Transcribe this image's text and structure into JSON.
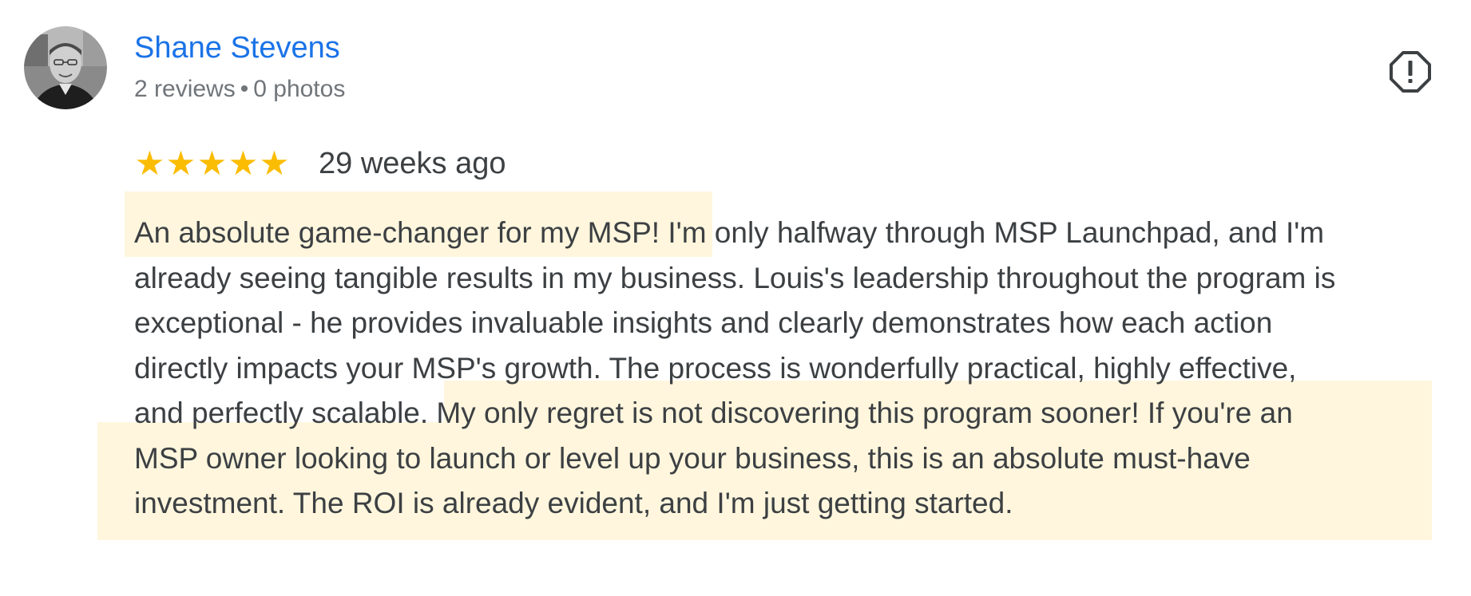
{
  "review": {
    "author": {
      "name": "Shane Stevens",
      "reviews_count": "2 reviews",
      "separator": "•",
      "photos_count": "0 photos",
      "avatar": "profile-photo"
    },
    "rating": {
      "stars": 5,
      "star_glyph": "★"
    },
    "timestamp": "29 weeks ago",
    "text_lines": [
      "An absolute game-changer for my MSP! I'm only halfway through MSP Launchpad, and I'm",
      "already seeing tangible results in my business. Louis's leadership throughout the program is",
      "exceptional - he provides invaluable insights and clearly demonstrates how each action",
      "directly impacts your MSP's growth. The process is wonderfully practical, highly effective,",
      "and perfectly scalable. My only regret is not discovering this program sooner! If you're an",
      "MSP owner looking to launch or level up your business, this is an absolute must-have",
      "investment. The ROI is already evident, and I'm just getting started."
    ],
    "flag_icon": "report-icon"
  },
  "colors": {
    "author_name": "#1a73e8",
    "meta_text": "#70757a",
    "body_text": "#3c4043",
    "star": "#fbbc04",
    "highlight": "#fff6dd"
  }
}
